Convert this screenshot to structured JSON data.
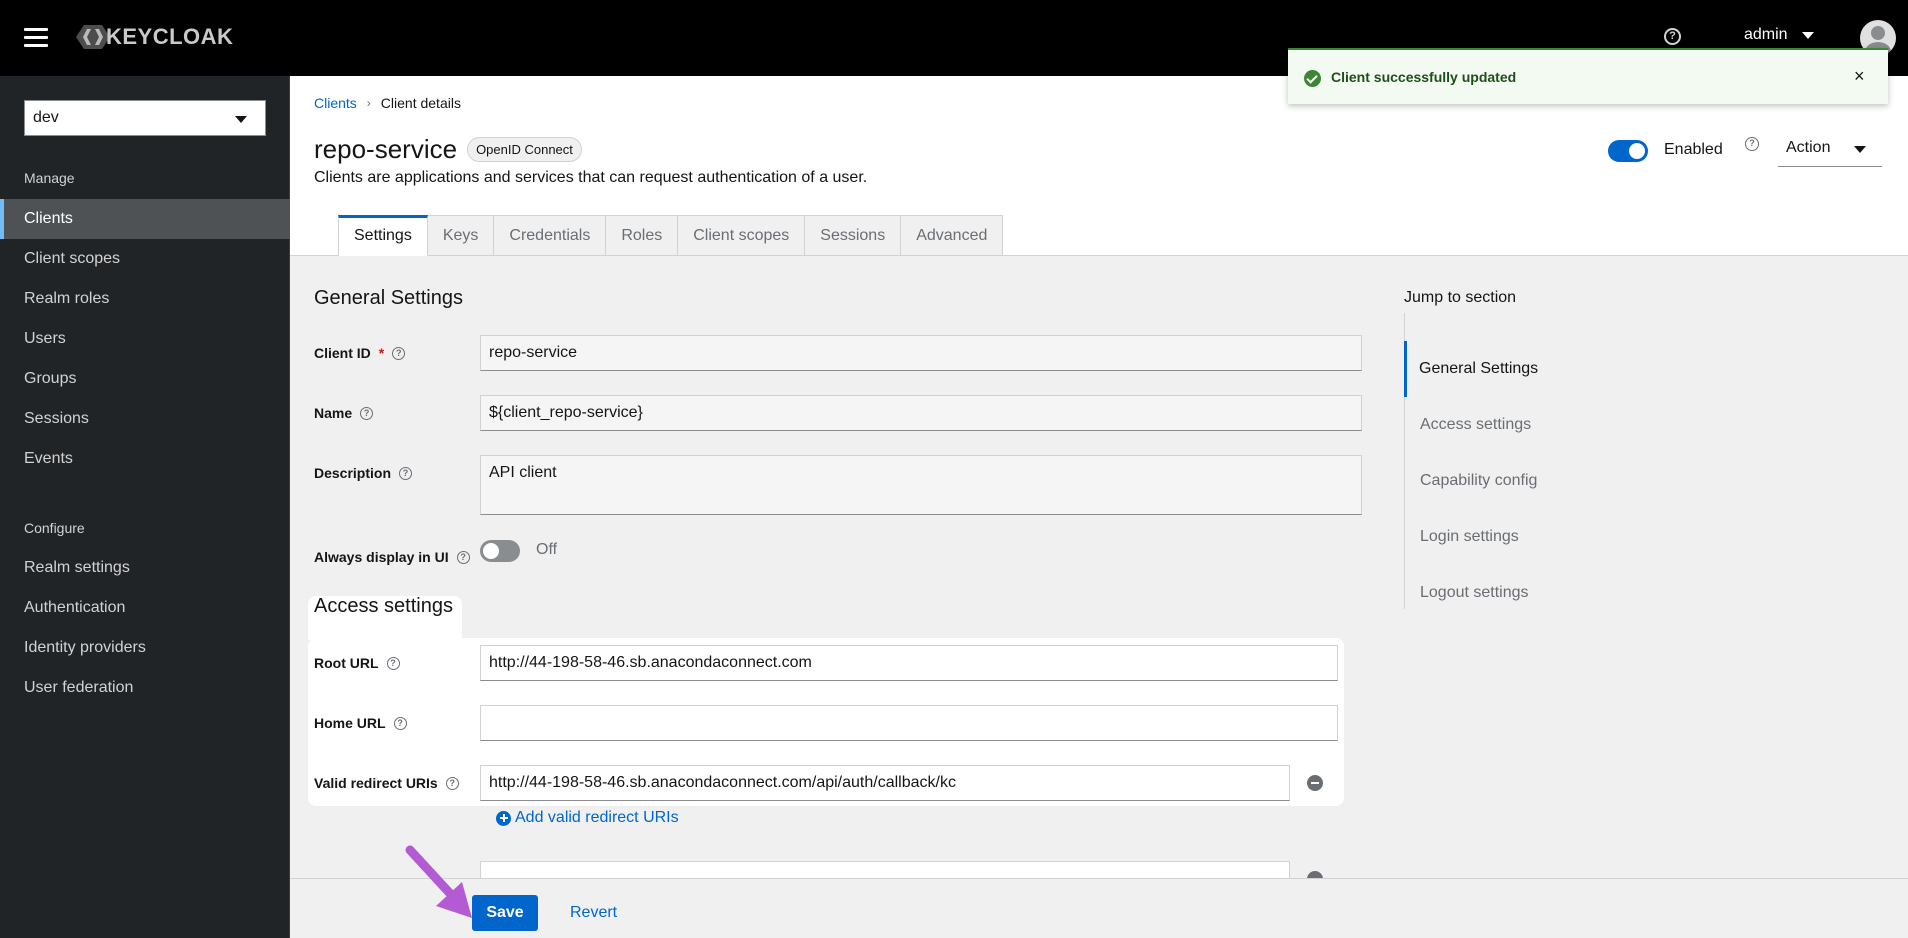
{
  "masthead": {
    "logo_text": "KEYCLOAK",
    "username": "admin"
  },
  "sidebar": {
    "realm": "dev",
    "manage_title": "Manage",
    "manage_items": [
      {
        "label": "Clients",
        "active": true
      },
      {
        "label": "Client scopes"
      },
      {
        "label": "Realm roles"
      },
      {
        "label": "Users"
      },
      {
        "label": "Groups"
      },
      {
        "label": "Sessions"
      },
      {
        "label": "Events"
      }
    ],
    "configure_title": "Configure",
    "configure_items": [
      {
        "label": "Realm settings"
      },
      {
        "label": "Authentication"
      },
      {
        "label": "Identity providers"
      },
      {
        "label": "User federation"
      }
    ]
  },
  "breadcrumb": {
    "parent": "Clients",
    "current": "Client details"
  },
  "header": {
    "title": "repo-service",
    "protocol_badge": "OpenID Connect",
    "subtitle": "Clients are applications and services that can request authentication of a user.",
    "enabled_label": "Enabled",
    "enabled": true,
    "action_label": "Action"
  },
  "tabs": [
    {
      "label": "Settings",
      "active": true
    },
    {
      "label": "Keys"
    },
    {
      "label": "Credentials"
    },
    {
      "label": "Roles"
    },
    {
      "label": "Client scopes"
    },
    {
      "label": "Sessions"
    },
    {
      "label": "Advanced"
    }
  ],
  "general": {
    "title": "General Settings",
    "client_id_label": "Client ID",
    "client_id_required": "*",
    "client_id_value": "repo-service",
    "name_label": "Name",
    "name_value": "${client_repo-service}",
    "description_label": "Description",
    "description_value": "API client",
    "always_display_label": "Always display in UI",
    "always_display_state": "Off"
  },
  "access": {
    "title": "Access settings",
    "root_url_label": "Root URL",
    "root_url_value": "http://44-198-58-46.sb.anacondaconnect.com",
    "home_url_label": "Home URL",
    "home_url_value": "",
    "redirect_label": "Valid redirect URIs",
    "redirect_value": "http://44-198-58-46.sb.anacondaconnect.com/api/auth/callback/kc",
    "add_redirect_label": "Add valid redirect URIs"
  },
  "jump": {
    "title": "Jump to section",
    "items": [
      {
        "label": "General Settings",
        "active": true
      },
      {
        "label": "Access settings"
      },
      {
        "label": "Capability config"
      },
      {
        "label": "Login settings"
      },
      {
        "label": "Logout settings"
      }
    ]
  },
  "footer": {
    "save_label": "Save",
    "revert_label": "Revert"
  },
  "toast": {
    "message": "Client successfully updated",
    "close": "×"
  },
  "colors": {
    "brand": "#0066cc",
    "success": "#3e8635",
    "annotation_arrow": "#b45bd3"
  }
}
